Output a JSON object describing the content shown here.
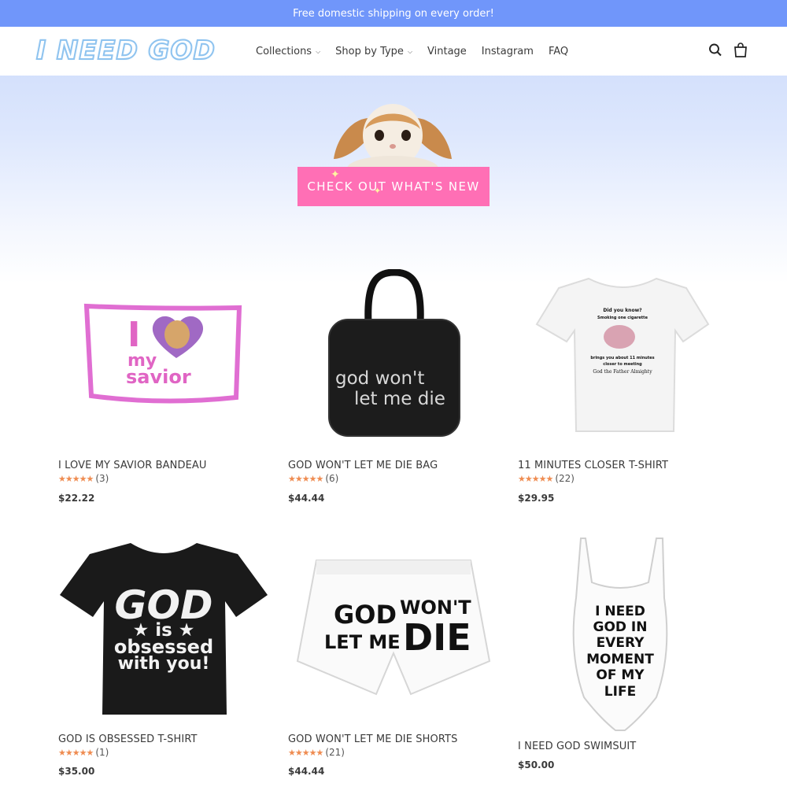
{
  "announcement": "Free domestic shipping on every order!",
  "logo": "I NEED GOD",
  "nav": [
    {
      "label": "Collections",
      "dropdown": true
    },
    {
      "label": "Shop by Type",
      "dropdown": true
    },
    {
      "label": "Vintage",
      "dropdown": false
    },
    {
      "label": "Instagram",
      "dropdown": false
    },
    {
      "label": "FAQ",
      "dropdown": false
    }
  ],
  "header_icons": [
    "search-icon",
    "cart-icon"
  ],
  "hero": {
    "cta": "CHECK OUT WHAT'S NEW"
  },
  "colors": {
    "announcement_bg": "#7096fa",
    "cta_bg": "#ff6fb5",
    "star": "#ef8c51"
  },
  "products": [
    {
      "title": "I LOVE MY SAVIOR BANDEAU",
      "stars": "★★★★★",
      "reviews": "(3)",
      "price": "$22.22",
      "art": {
        "i": "I",
        "my": "my",
        "savior": "savior"
      }
    },
    {
      "title": "GOD WON'T LET ME DIE BAG",
      "stars": "★★★★★",
      "reviews": "(6)",
      "price": "$44.44",
      "art": {
        "l1": "god won't",
        "l2": "let me die"
      }
    },
    {
      "title": "11 MINUTES CLOSER T-SHIRT",
      "stars": "★★★★★",
      "reviews": "(22)",
      "price": "$29.95",
      "art": {
        "l1": "Did you know?",
        "l2": "Smoking one cigarette",
        "l3": "brings you about 11 minutes",
        "l4": "closer to meeting",
        "l5": "God the Father Almighty"
      }
    },
    {
      "title": "GOD IS OBSESSED T-SHIRT",
      "stars": "★★★★★",
      "reviews": "(1)",
      "price": "$35.00",
      "art": {
        "l1": "GOD",
        "l2": "★ is ★",
        "l3": "obsessed",
        "l4": "with you!"
      }
    },
    {
      "title": "GOD WON'T LET ME DIE SHORTS",
      "stars": "★★★★★",
      "reviews": "(21)",
      "price": "$44.44",
      "art": {
        "l1": "GOD",
        "l2": "LET ME",
        "l3": "WON'T",
        "l4": "DIE"
      }
    },
    {
      "title": "I NEED GOD SWIMSUIT",
      "stars": "",
      "reviews": "",
      "price": "$50.00",
      "art": {
        "l1": "I NEED",
        "l2": "GOD IN",
        "l3": "EVERY",
        "l4": "MOMENT",
        "l5": "OF MY",
        "l6": "LIFE"
      }
    }
  ]
}
